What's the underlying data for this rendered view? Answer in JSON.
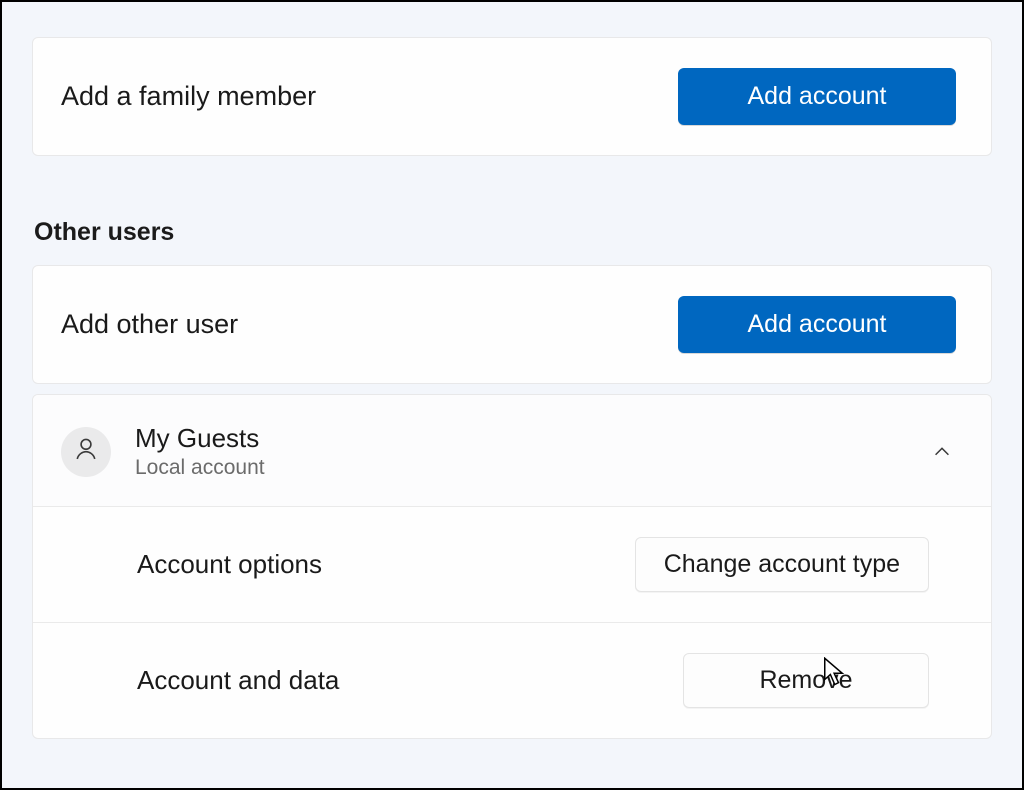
{
  "family": {
    "add_member_label": "Add a family member",
    "add_account_button": "Add account"
  },
  "other_users": {
    "section_title": "Other users",
    "add_other_label": "Add other user",
    "add_account_button": "Add account",
    "user": {
      "name": "My Guests",
      "subtitle": "Local account",
      "account_options_label": "Account options",
      "change_type_button": "Change account type",
      "account_data_label": "Account and data",
      "remove_button": "Remove"
    }
  }
}
